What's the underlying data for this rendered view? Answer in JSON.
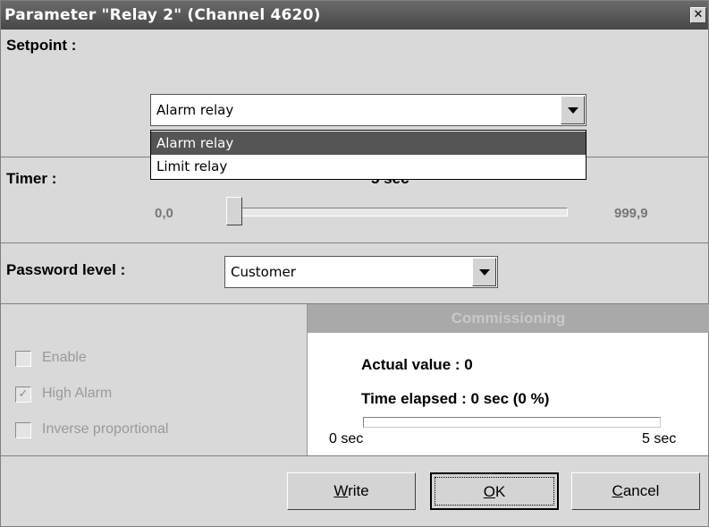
{
  "window": {
    "title": "Parameter \"Relay 2\" (Channel 4620)",
    "close_symbol": "✕"
  },
  "setpoint": {
    "label": "Setpoint :",
    "selected": "Alarm relay",
    "options": [
      "Alarm relay",
      "Limit relay"
    ]
  },
  "timer": {
    "label": "Timer :",
    "current_value": "5 sec",
    "min_label": "0,0",
    "max_label": "999,9"
  },
  "password": {
    "label": "Password level :",
    "selected": "Customer"
  },
  "options": {
    "enable": {
      "label": "Enable",
      "checked": false
    },
    "high_alarm": {
      "label": "High Alarm",
      "checked": true
    },
    "inverse": {
      "label": "Inverse proportional",
      "checked": false
    }
  },
  "commissioning": {
    "header": "Commissioning",
    "actual_value": "Actual value : 0",
    "time_elapsed": "Time elapsed : 0 sec (0 %)",
    "progress_percent": 0,
    "start_label": "0 sec",
    "end_label": "5 sec"
  },
  "buttons": {
    "write": {
      "prefix": "",
      "mnemonic": "W",
      "rest": "rite"
    },
    "ok": {
      "prefix": "",
      "mnemonic": "O",
      "rest": "K"
    },
    "cancel": {
      "prefix": "",
      "mnemonic": "C",
      "rest": "ancel"
    }
  },
  "colors": {
    "titlebar": "#474747",
    "dialog_bg": "#d9d9d9",
    "selection": "#555555"
  }
}
